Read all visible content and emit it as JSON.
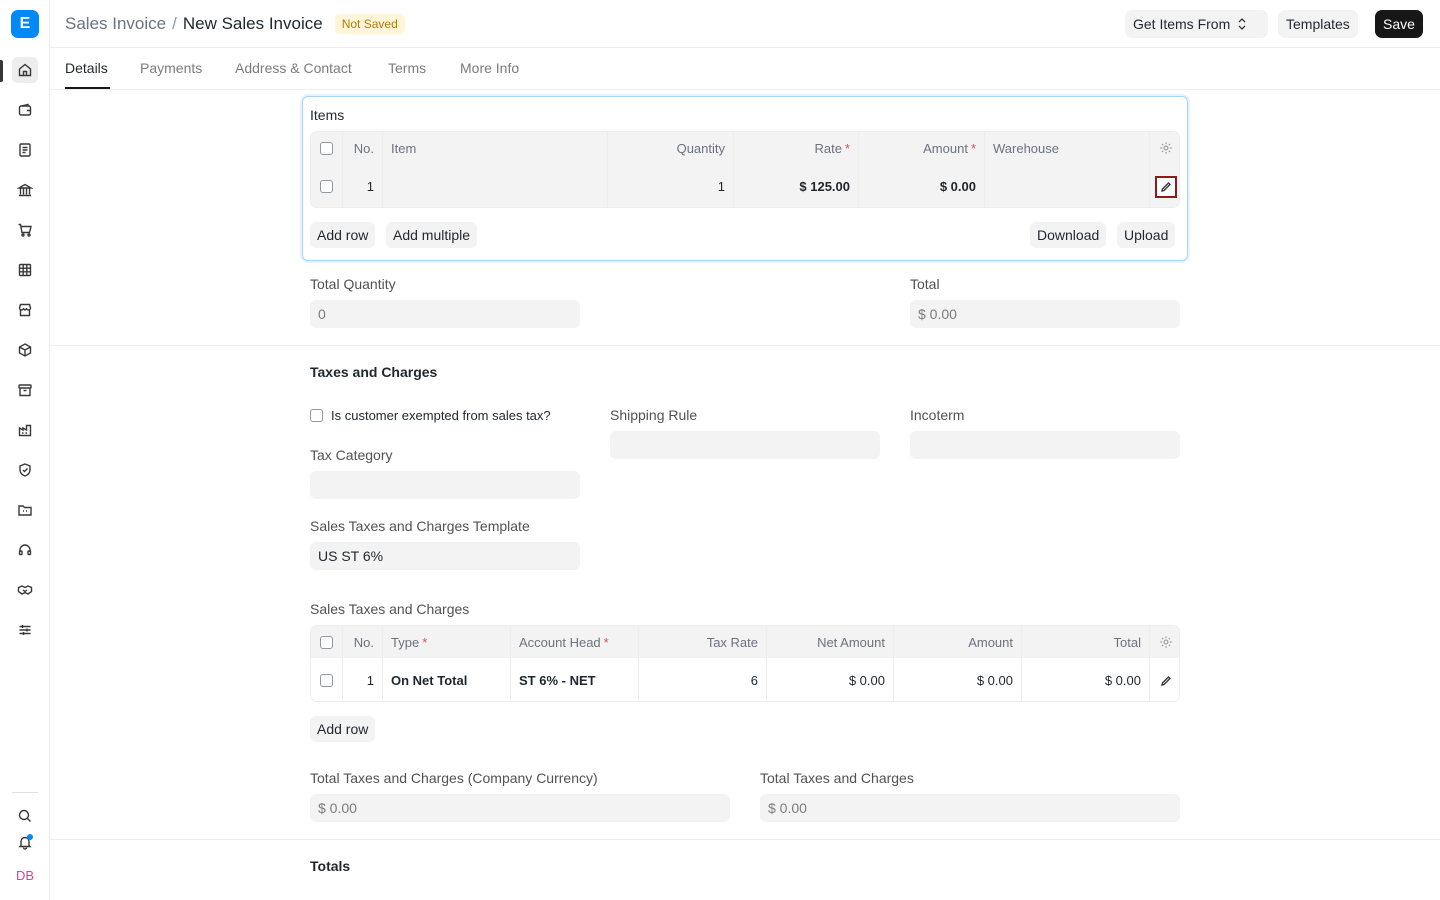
{
  "app": {
    "logo_letter": "E",
    "user_initials": "DB"
  },
  "sidebar": {
    "icons": [
      "home-icon",
      "wallet-icon",
      "file-text-icon",
      "bank-icon",
      "cart-icon",
      "table-icon",
      "store-icon",
      "package-icon",
      "archive-icon",
      "factory-icon",
      "shield-icon",
      "folder-icon",
      "headset-icon",
      "handshake-icon",
      "sliders-icon"
    ],
    "bottom_icons": [
      "search-icon",
      "bell-icon"
    ]
  },
  "header": {
    "breadcrumb_parent": "Sales Invoice",
    "breadcrumb_sep": "/",
    "title": "New Sales Invoice",
    "status_badge": "Not Saved",
    "get_items_label": "Get Items From",
    "templates_label": "Templates",
    "save_label": "Save"
  },
  "tabs": [
    "Details",
    "Payments",
    "Address & Contact",
    "Terms",
    "More Info"
  ],
  "items": {
    "section_label": "Items",
    "columns": {
      "no": "No.",
      "item": "Item",
      "quantity": "Quantity",
      "rate": "Rate",
      "amount": "Amount",
      "warehouse": "Warehouse"
    },
    "rows": [
      {
        "no": "1",
        "item": "",
        "quantity": "1",
        "rate": "$ 125.00",
        "amount": "$ 0.00",
        "warehouse": ""
      }
    ],
    "add_row": "Add row",
    "add_multiple": "Add multiple",
    "download": "Download",
    "upload": "Upload"
  },
  "totals_top": {
    "total_quantity_label": "Total Quantity",
    "total_quantity_value": "0",
    "total_label": "Total",
    "total_value": "$ 0.00"
  },
  "taxes": {
    "section_title": "Taxes and Charges",
    "exempt_label": "Is customer exempted from sales tax?",
    "shipping_rule_label": "Shipping Rule",
    "incoterm_label": "Incoterm",
    "tax_category_label": "Tax Category",
    "template_label": "Sales Taxes and Charges Template",
    "template_value": "US ST 6%",
    "table_label": "Sales Taxes and Charges",
    "columns": {
      "no": "No.",
      "type": "Type",
      "account_head": "Account Head",
      "tax_rate": "Tax Rate",
      "net_amount": "Net Amount",
      "amount": "Amount",
      "total": "Total"
    },
    "rows": [
      {
        "no": "1",
        "type": "On Net Total",
        "account_head": "ST 6% - NET",
        "tax_rate": "6",
        "net_amount": "$ 0.00",
        "amount": "$ 0.00",
        "total": "$ 0.00"
      }
    ],
    "add_row": "Add row",
    "total_company_label": "Total Taxes and Charges (Company Currency)",
    "total_company_value": "$ 0.00",
    "total_label": "Total Taxes and Charges",
    "total_value": "$ 0.00"
  },
  "totals_section": {
    "title": "Totals"
  }
}
